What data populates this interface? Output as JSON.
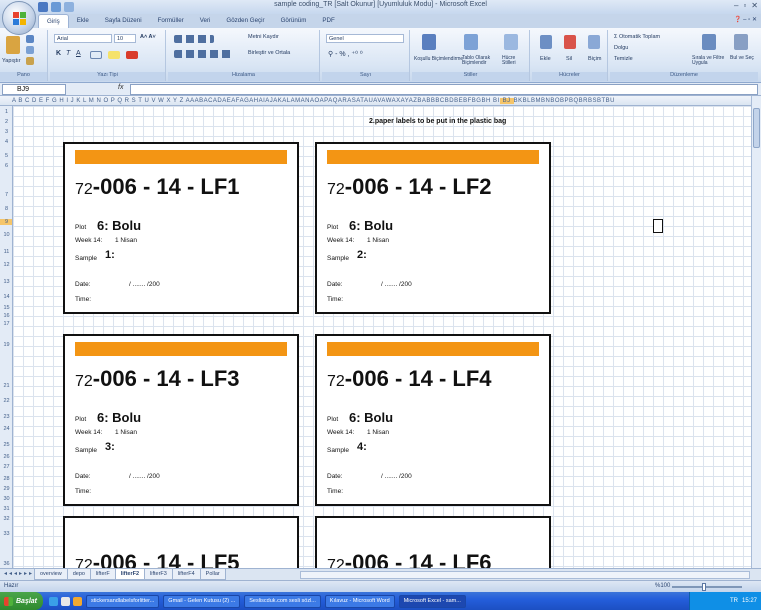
{
  "window": {
    "title": "sample coding_TR [Salt Okunur] [Uyumluluk Modu] - Microsoft Excel",
    "controls": [
      "–",
      "▫",
      "✕"
    ]
  },
  "ribbon_tabs": [
    "Giriş",
    "Ekle",
    "Sayfa Düzeni",
    "Formüller",
    "Veri",
    "Gözden Geçir",
    "Görünüm",
    "PDF"
  ],
  "ribbon": {
    "paste_label": "Yapıştır",
    "font_name": "Arial",
    "font_size": "10",
    "wrap_text": "Metni Kaydır",
    "merge_center": "Birleştir ve Ortala",
    "number_format": "Genel",
    "cond_format": "Koşullu Biçimlendirme",
    "format_table": "Tablo Olarak Biçimlendir",
    "cell_styles": "Hücre Stilleri",
    "insert": "Ekle",
    "delete": "Sil",
    "format": "Biçim",
    "autosum": "Otomatik Toplam",
    "fill": "Dolgu",
    "clear": "Temizle",
    "sort_filter": "Sırala ve Filtre Uygula",
    "find_select": "Bul ve Seç",
    "groups": [
      "Pano",
      "Yazı Tipi",
      "Hizalama",
      "Sayı",
      "Stiller",
      "Hücreler",
      "Düzenleme"
    ]
  },
  "formula_bar": {
    "name_box": "BJ9",
    "fx": "fx",
    "value": ""
  },
  "columns_text": "A B C D E F G H I J K L M N O P Q R S T U V W X Y Z AAABACADAEAFAGAHAIAJAKALAMANAOAPAQARASATAUAVAWAXAYAZBABBBCBDBEBFBGBH BI",
  "columns_highlight": "BJ",
  "columns_tail": "BKBLBMBNBOBPBQBRBSBTBU",
  "rows": [
    "1",
    "2",
    "3",
    "4",
    "5",
    "6",
    "7",
    "8",
    "9",
    "10",
    "11",
    "12",
    "13",
    "14",
    "15",
    "16",
    "17",
    "18",
    "19",
    "20",
    "21",
    "22",
    "23",
    "24",
    "25",
    "26",
    "27",
    "28",
    "29",
    "30",
    "31",
    "32",
    "33",
    "34",
    "35",
    "36"
  ],
  "note": "2.paper labels to be put in the plastic bag",
  "labels": [
    {
      "prefix": "72",
      "code": "-006 - 14 - LF1",
      "plot_label": "Plot",
      "plot": "6:  Bolu",
      "week_label": "Week 14:",
      "week_value": "1 Nisan",
      "sample_label": "Sample",
      "sample": "1:",
      "date_label": "Date:",
      "date_value": "/ ....... /200",
      "time_label": "Time:"
    },
    {
      "prefix": "72",
      "code": "-006 - 14 - LF2",
      "plot_label": "Plot",
      "plot": "6:  Bolu",
      "week_label": "Week 14:",
      "week_value": "1 Nisan",
      "sample_label": "Sample",
      "sample": "2:",
      "date_label": "Date:",
      "date_value": "/ ....... /200",
      "time_label": "Time:"
    },
    {
      "prefix": "72",
      "code": "-006 - 14 - LF3",
      "plot_label": "Plot",
      "plot": "6:  Bolu",
      "week_label": "Week 14:",
      "week_value": "1 Nisan",
      "sample_label": "Sample",
      "sample": "3:",
      "date_label": "Date:",
      "date_value": "/ ....... /200",
      "time_label": "Time:"
    },
    {
      "prefix": "72",
      "code": "-006 - 14 - LF4",
      "plot_label": "Plot",
      "plot": "6:  Bolu",
      "week_label": "Week 14:",
      "week_value": "1 Nisan",
      "sample_label": "Sample",
      "sample": "4:",
      "date_label": "Date:",
      "date_value": "/ ....... /200",
      "time_label": "Time:"
    },
    {
      "prefix": "72",
      "code": "-006 - 14 - LF5"
    },
    {
      "prefix": "72",
      "code": "-006 - 14 - LF6"
    }
  ],
  "sheet_tabs": [
    "overview",
    "depo",
    "lifterF",
    "lifterF2",
    "lifterF3",
    "lifterF4",
    "Pollar"
  ],
  "active_sheet": "lifterF2",
  "status": {
    "text": "Hazır",
    "zoom": "%100"
  },
  "taskbar": {
    "start": "Başlat",
    "tasks": [
      "stickersandlabelsforlitter...",
      "Gmail - Gelen Kutusu (2) ...",
      "Sesliscduk.com sesli sözl...",
      "Kılavuz - Microsoft Word",
      "Microsoft Excel - sam..."
    ],
    "active_task": "Microsoft Excel - sam...",
    "clock": "15:27"
  },
  "colors": {
    "label_bar": "#f39514",
    "ribbon": "#d9e5f4",
    "taskbar": "#245edb"
  }
}
